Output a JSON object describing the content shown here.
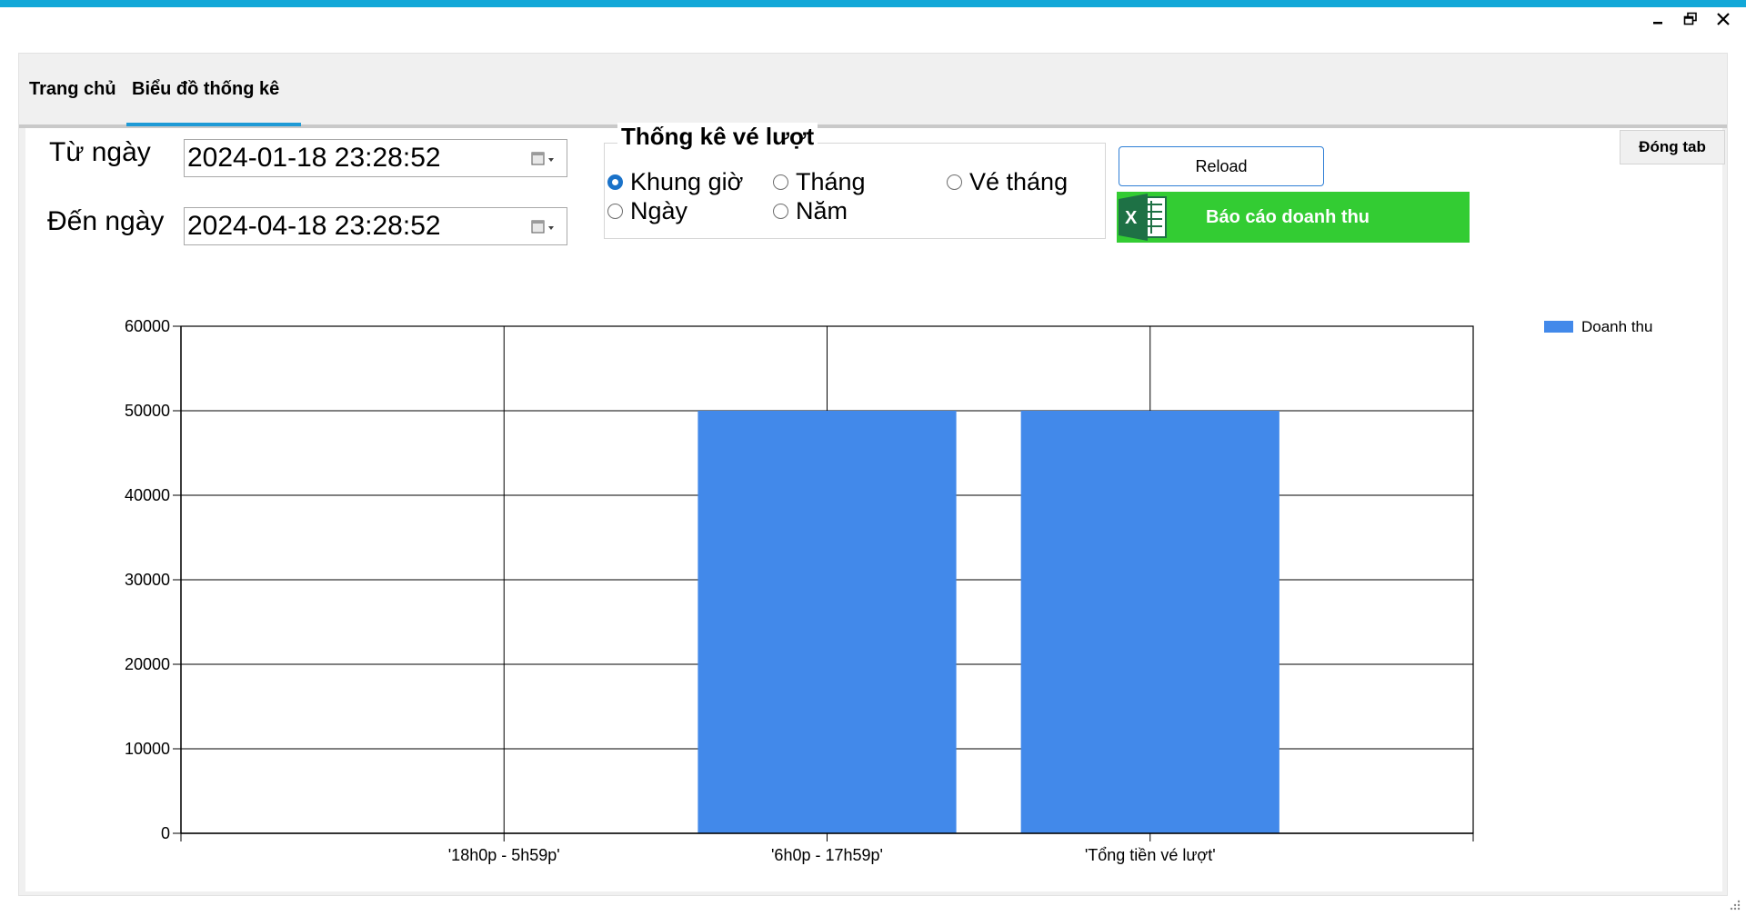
{
  "tabs": [
    {
      "label": "Trang chủ"
    },
    {
      "label": "Biểu đồ thống kê",
      "active": true
    }
  ],
  "filters": {
    "from_label": "Từ ngày",
    "from_value": "2024-01-18 23:28:52",
    "to_label": "Đến ngày",
    "to_value": "2024-04-18 23:28:52"
  },
  "stats_group": {
    "title": "Thống kê vé lượt",
    "options": [
      {
        "label": "Khung giờ",
        "checked": true
      },
      {
        "label": "Tháng",
        "checked": false
      },
      {
        "label": "Vé tháng",
        "checked": false
      },
      {
        "label": "Ngày",
        "checked": false
      },
      {
        "label": "Năm",
        "checked": false
      }
    ]
  },
  "buttons": {
    "reload": "Reload",
    "report": "Báo cáo doanh thu",
    "close_tab": "Đóng tab"
  },
  "colors": {
    "accent_bar": "#12a8d8",
    "bar": "#4289ea",
    "report_button": "#33cc33",
    "excel_green": "#1e7145"
  },
  "chart_data": {
    "type": "bar",
    "categories": [
      "'18h0p - 5h59p'",
      "'6h0p - 17h59p'",
      "'Tổng tiền vé lượt'"
    ],
    "series": [
      {
        "name": "Doanh thu",
        "values": [
          0,
          50000,
          50000
        ]
      }
    ],
    "ylim": [
      0,
      60000
    ],
    "yticks": [
      "0",
      "10000",
      "20000",
      "30000",
      "40000",
      "50000",
      "60000"
    ],
    "grid": true,
    "legend": "top-right"
  }
}
